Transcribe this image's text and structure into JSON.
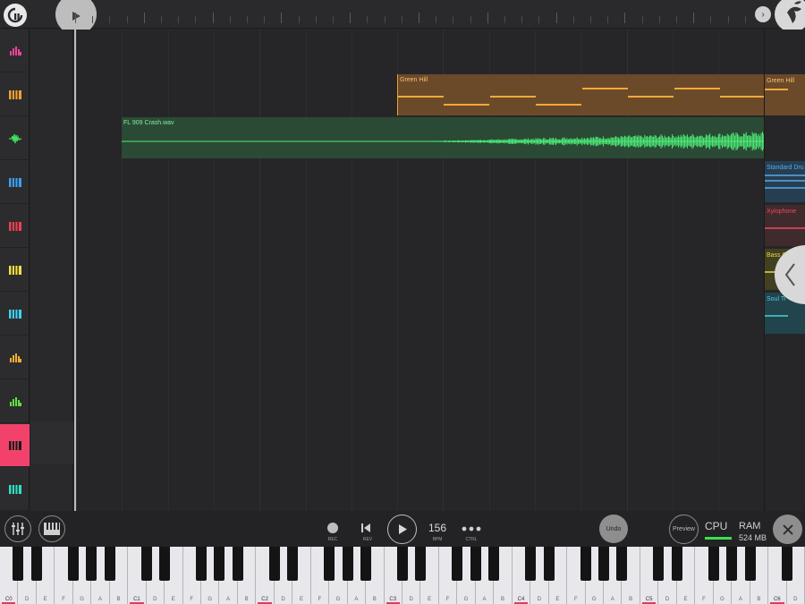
{
  "clips": {
    "green_hill_label": "Green Hill",
    "crash_label": "FL 909 Crash.wav",
    "green_hill_right_label": "Green Hill"
  },
  "right_panel": {
    "items": [
      {
        "label": "Standard Dru",
        "color": "#5aa8e8"
      },
      {
        "label": "Xylophone",
        "color": "#f04a5a"
      },
      {
        "label": "Bass O",
        "color": "#e8d84a"
      },
      {
        "label": "Soul Ti",
        "color": "#4ad0e0"
      }
    ]
  },
  "channels": [
    {
      "icon": "drum-icon",
      "color": "#f0429a"
    },
    {
      "icon": "keys-icon",
      "color": "#f0a030"
    },
    {
      "icon": "waveform-icon",
      "color": "#40e060"
    },
    {
      "icon": "keys-icon",
      "color": "#3aa0f0"
    },
    {
      "icon": "keys-icon",
      "color": "#f04050"
    },
    {
      "icon": "keys-icon",
      "color": "#f0e040"
    },
    {
      "icon": "keys-icon",
      "color": "#40d0f0"
    },
    {
      "icon": "drum-icon",
      "color": "#f0b030"
    },
    {
      "icon": "drum-icon",
      "color": "#60e040"
    },
    {
      "icon": "keys-icon",
      "color": "#1a1a1a"
    },
    {
      "icon": "keys-icon",
      "color": "#30e0c0"
    }
  ],
  "transport": {
    "rec_label": "REC",
    "rev_label": "REV",
    "bpm_value": "156",
    "bpm_label": "BPM",
    "ctrl_label": "CTRL",
    "undo_label": "Undo",
    "preview_label": "Preview",
    "cpu_label": "CPU",
    "ram_label": "RAM",
    "ram_value": "524 MB"
  },
  "keyboard": {
    "note_labels": [
      "C0",
      "D",
      "E",
      "F",
      "G",
      "A",
      "B",
      "C1",
      "D",
      "E",
      "F",
      "G",
      "A",
      "B",
      "C2",
      "D",
      "E",
      "F",
      "G",
      "A",
      "B",
      "C3",
      "D",
      "E",
      "F",
      "G",
      "A",
      "B",
      "C4",
      "D",
      "E",
      "F",
      "G",
      "A",
      "B",
      "C5",
      "D",
      "E",
      "F",
      "G",
      "A",
      "B",
      "C6",
      "D"
    ]
  },
  "colors": {
    "accent": "#f2426b",
    "green_hill": "#f0a030",
    "crash": "#4ef07a",
    "cpu_meter": "#3be04d"
  }
}
